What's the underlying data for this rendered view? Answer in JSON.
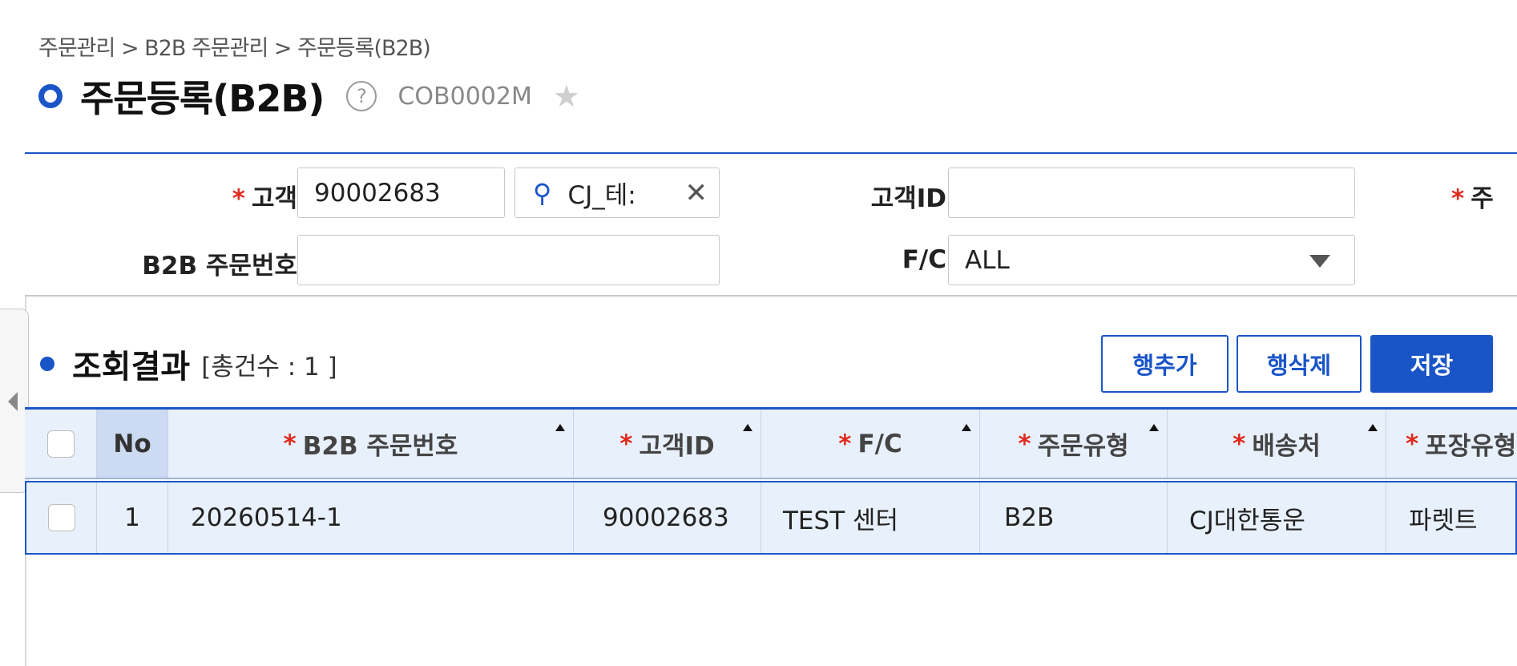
{
  "breadcrumb": "주문관리 > B2B 주문관리 > 주문등록(B2B)",
  "page": {
    "title": "주문등록(B2B)",
    "help_glyph": "?",
    "code": "COB0002M",
    "star_glyph": "★"
  },
  "search": {
    "customer_label": "고객",
    "customer_code": "90002683",
    "customer_name": "CJ_테:",
    "customer_id_label": "고객ID",
    "customer_id_value": "",
    "order_type_label_partial": "주",
    "b2b_order_no_label": "B2B 주문번호",
    "b2b_order_no_value": "",
    "fc_label": "F/C",
    "fc_value": "ALL",
    "required_mark": "*",
    "clear_glyph": "✕",
    "search_glyph": "⚲"
  },
  "result": {
    "title": "조회결과",
    "count_text": "[총건수 :  1 ]",
    "add_row_label": "행추가",
    "delete_row_label": "행삭제",
    "save_label": "저장"
  },
  "grid": {
    "columns": [
      {
        "label": "No",
        "required": false,
        "sortable": false
      },
      {
        "label": "B2B 주문번호",
        "required": true,
        "sortable": true
      },
      {
        "label": "고객ID",
        "required": true,
        "sortable": true
      },
      {
        "label": "F/C",
        "required": true,
        "sortable": true
      },
      {
        "label": "주문유형",
        "required": true,
        "sortable": true
      },
      {
        "label": "배송처",
        "required": true,
        "sortable": true
      },
      {
        "label": "포장유형",
        "required": true,
        "sortable": false
      }
    ],
    "rows": [
      {
        "no": "1",
        "b2b_order_no": "20260514-1",
        "customer_id": "90002683",
        "fc": "TEST 센터",
        "order_type": "B2B",
        "ship_to": "CJ대한통운",
        "pack_type": "파렛트"
      }
    ]
  },
  "colors": {
    "accent": "#1a55c8",
    "required": "#e0291d",
    "grid_header_bg": "#e8f0fb"
  }
}
